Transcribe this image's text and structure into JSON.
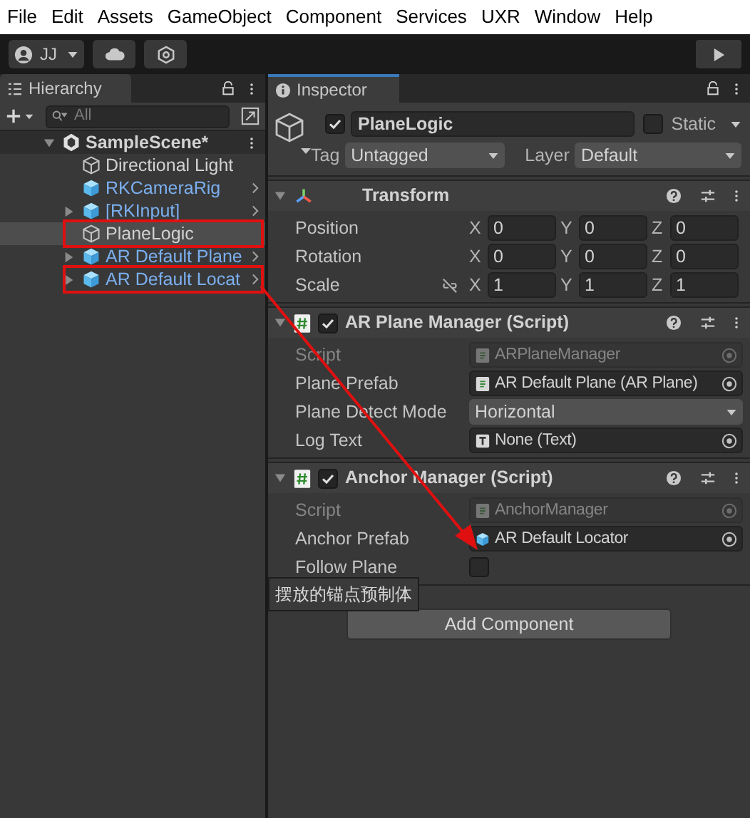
{
  "menu": [
    "File",
    "Edit",
    "Assets",
    "GameObject",
    "Component",
    "Services",
    "UXR",
    "Window",
    "Help"
  ],
  "toolbar": {
    "account": "JJ"
  },
  "hierarchy": {
    "tab": "Hierarchy",
    "search": {
      "placeholder": "All"
    },
    "items": [
      {
        "label": "SampleScene*",
        "kind": "scene",
        "expanded": true,
        "selected": false,
        "marked": false,
        "children": [
          {
            "label": "Directional Light",
            "kind": "object",
            "selected": false,
            "marked": false
          },
          {
            "label": "RKCameraRig",
            "kind": "prefab",
            "selected": false,
            "marked": false
          },
          {
            "label": "[RKInput]",
            "kind": "prefab",
            "expanded": false,
            "selected": false,
            "marked": false
          },
          {
            "label": "PlaneLogic",
            "kind": "object",
            "selected": true,
            "marked": true
          },
          {
            "label": "AR Default Plane",
            "kind": "prefab",
            "expanded": false,
            "selected": false,
            "marked": false
          },
          {
            "label": "AR Default Locat",
            "kind": "prefab",
            "expanded": false,
            "selected": false,
            "marked": true
          }
        ]
      }
    ]
  },
  "inspector": {
    "tab": "Inspector",
    "object": {
      "enabled": true,
      "name": "PlaneLogic",
      "static": false,
      "static_label": "Static",
      "tag_label": "Tag",
      "tag": "Untagged",
      "layer_label": "Layer",
      "layer": "Default"
    },
    "components": [
      {
        "title": "Transform",
        "kind": "transform",
        "expanded": true,
        "rows": [
          {
            "label": "Position",
            "kind": "vector3",
            "values": [
              {
                "axis": "X",
                "value": "0"
              },
              {
                "axis": "Y",
                "value": "0"
              },
              {
                "axis": "Z",
                "value": "0"
              }
            ]
          },
          {
            "label": "Rotation",
            "kind": "vector3",
            "values": [
              {
                "axis": "X",
                "value": "0"
              },
              {
                "axis": "Y",
                "value": "0"
              },
              {
                "axis": "Z",
                "value": "0"
              }
            ]
          },
          {
            "label": "Scale",
            "kind": "vector3",
            "linked": false,
            "values": [
              {
                "axis": "X",
                "value": "1"
              },
              {
                "axis": "Y",
                "value": "1"
              },
              {
                "axis": "Z",
                "value": "1"
              }
            ]
          }
        ]
      },
      {
        "title": "AR Plane Manager (Script)",
        "kind": "script",
        "enabled": true,
        "expanded": true,
        "rows": [
          {
            "label": "Script",
            "kind": "script_ref",
            "value": "ARPlaneManager",
            "disabled": true
          },
          {
            "label": "Plane Prefab",
            "kind": "component_ref",
            "value": "AR Default Plane (AR Plane)",
            "disabled": false
          },
          {
            "label": "Plane Detect Mode",
            "kind": "dropdown",
            "value": "Horizontal"
          },
          {
            "label": "Log Text",
            "kind": "text_ref",
            "value": "None (Text)",
            "disabled": false
          }
        ]
      },
      {
        "title": "Anchor Manager (Script)",
        "kind": "script",
        "enabled": true,
        "expanded": true,
        "rows": [
          {
            "label": "Script",
            "kind": "script_ref",
            "value": "AnchorManager",
            "disabled": true
          },
          {
            "label": "Anchor Prefab",
            "kind": "prefab_ref",
            "value": "AR Default Locator",
            "disabled": false
          },
          {
            "label": "Follow Plane",
            "kind": "toggle",
            "checked": false
          }
        ]
      }
    ],
    "tooltip": "摆放的锚点预制体",
    "add_component": "Add Component"
  },
  "annotation_arrow": true
}
